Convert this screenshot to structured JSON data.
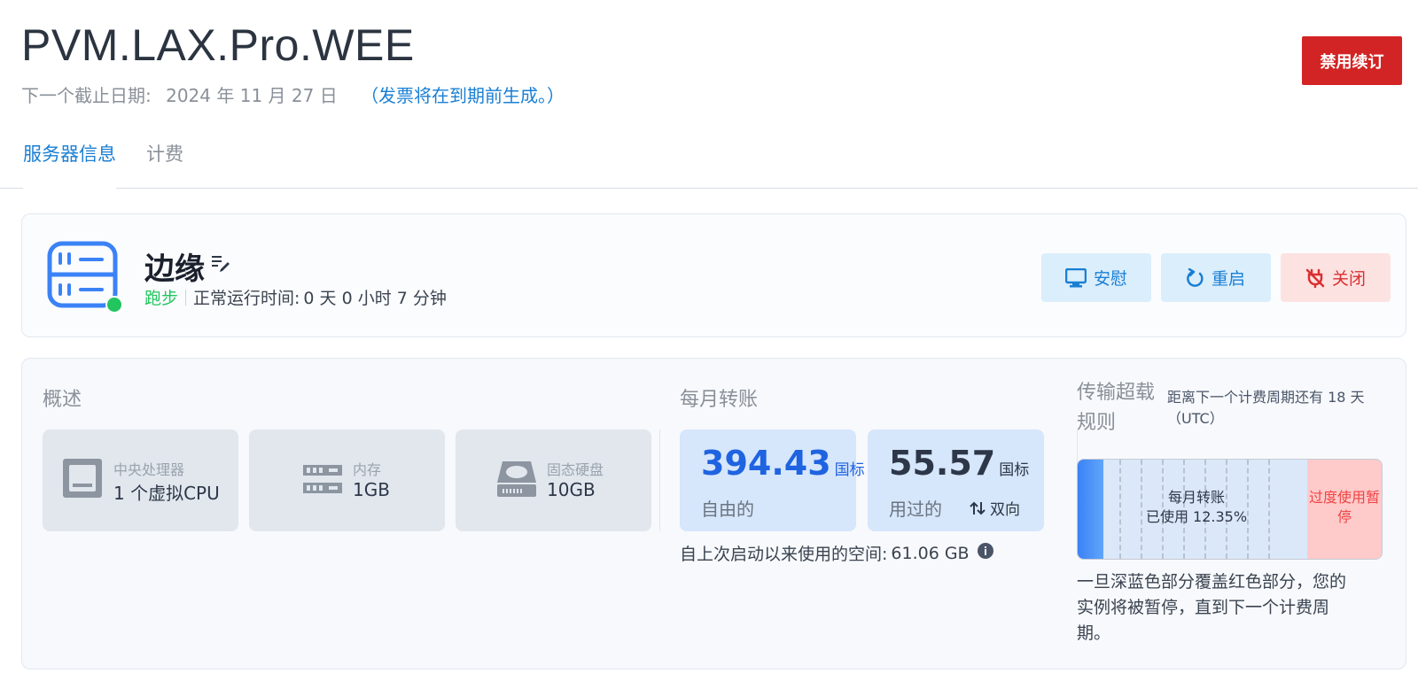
{
  "header": {
    "title": "PVM.LAX.Pro.WEE",
    "due_label": "下一个截止日期:",
    "due_date": "2024 年 11 月 27 日",
    "invoice_note": "（发票将在到期前生成。）",
    "disable_renew_label": "禁用续订"
  },
  "tabs": [
    {
      "label": "服务器信息",
      "active": true
    },
    {
      "label": "计费",
      "active": false
    }
  ],
  "server": {
    "name": "边缘",
    "status": "跑步",
    "uptime_label": "正常运行时间:",
    "uptime_value": "0 天 0 小时 7 分钟",
    "status_color": "#22c55e",
    "actions": {
      "console": "安慰",
      "reboot": "重启",
      "shutdown": "关闭"
    }
  },
  "overview": {
    "title": "概述",
    "cpu": {
      "label": "中央处理器",
      "value": "1 个虚拟CPU",
      "icon": "cpu-icon"
    },
    "ram": {
      "label": "内存",
      "value": "1GB",
      "icon": "memory-icon"
    },
    "disk": {
      "label": "固态硬盘",
      "value": "10GB",
      "icon": "disk-icon"
    }
  },
  "monthly_transfer": {
    "title": "每月转账",
    "free": {
      "value": "394.43",
      "unit": "国标",
      "label": "自由的"
    },
    "used": {
      "value": "55.57",
      "unit": "国标",
      "label": "用过的",
      "direction": "双向"
    },
    "space_since_boot_label": "自上次启动以来使用的空间:",
    "space_since_boot_value": "61.06 GB"
  },
  "overage": {
    "title": "传输超载规则",
    "note": "距离下一个计费周期还有 18 天（UTC）",
    "bar_label_line1": "每月转账",
    "bar_label_line2": "已使用 12.35%",
    "used_fraction": 0.1235,
    "over_label": "过度使用暂停",
    "description": "一旦深蓝色部分覆盖红色部分，您的实例将被暂停，直到下一个计费周期。"
  },
  "colors": {
    "accent": "#1a7fd4",
    "danger": "#d22424",
    "free_value": "#1e63e0"
  }
}
